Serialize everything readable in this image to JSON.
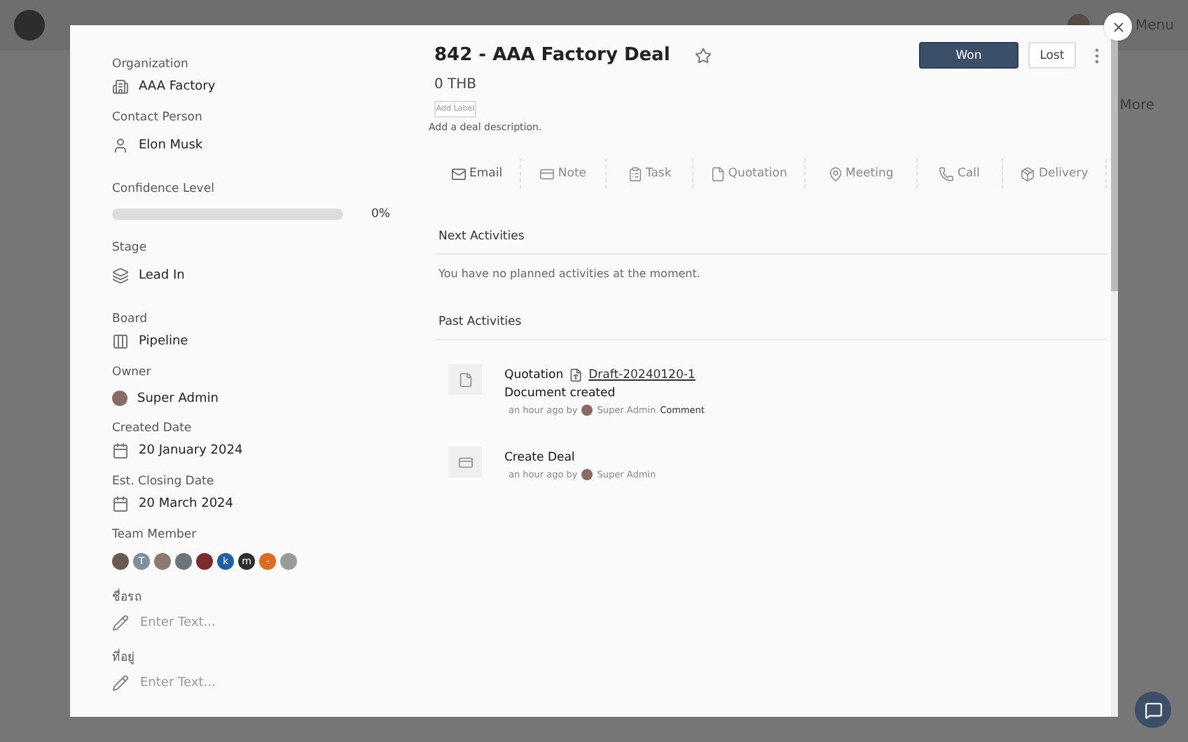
{
  "background": {
    "menu": "Menu",
    "more": "More"
  },
  "deal": {
    "title": "842 - AAA Factory Deal",
    "starred": false,
    "amount": "0 THB",
    "add_label": "Add Label",
    "description": "Add a deal description.",
    "won": "Won",
    "lost": "Lost"
  },
  "fields": [
    {
      "kind": "organization",
      "label": "Organization",
      "value": "AAA Factory"
    },
    {
      "kind": "contact",
      "label": "Contact Person",
      "value": "Elon Musk"
    },
    {
      "kind": "confidence",
      "label": "Confidence Level",
      "level": 0,
      "reading": "0%"
    },
    {
      "kind": "stage",
      "label": "Stage",
      "value": "Lead In"
    },
    {
      "kind": "board",
      "label": "Board",
      "value": "Pipeline"
    },
    {
      "kind": "owner",
      "label": "Owner",
      "value": "Super Admin"
    },
    {
      "kind": "date",
      "label": "Created Date",
      "value": "20 January 2024"
    },
    {
      "kind": "date",
      "label": "Est. Closing Date",
      "value": "20 March 2024"
    },
    {
      "kind": "team",
      "label": "Team Member"
    },
    {
      "kind": "input",
      "label": "ชื่อรถ",
      "placeholder": "Enter Text..."
    },
    {
      "kind": "input",
      "label": "ที่อยู่",
      "placeholder": "Enter Text..."
    }
  ],
  "team": [
    {
      "color": "#6b5a52"
    },
    {
      "color": "#7d8e9c",
      "initial": "T"
    },
    {
      "color": "#8a7a70"
    },
    {
      "color": "#6f7478"
    },
    {
      "color": "#7a2b2b"
    },
    {
      "color": "#1f5fa8",
      "initial": "k"
    },
    {
      "color": "#2e2e2e",
      "initial": "m"
    },
    {
      "color": "#e06a1e",
      "initial": "-"
    },
    {
      "color": "#9a9a9a"
    }
  ],
  "actions": [
    {
      "kind": "email",
      "label": "Email"
    },
    {
      "kind": "note",
      "label": "Note"
    },
    {
      "kind": "task",
      "label": "Task"
    },
    {
      "kind": "quotation",
      "label": "Quotation"
    },
    {
      "kind": "meeting",
      "label": "Meeting"
    },
    {
      "kind": "call",
      "label": "Call"
    },
    {
      "kind": "delivery",
      "label": "Delivery"
    }
  ],
  "next_activities": {
    "title": "Next Activities",
    "empty": "You have no planned activities at the moment."
  },
  "past_activities": {
    "title": "Past Activities",
    "items": [
      {
        "kind": "document",
        "type": "Quotation",
        "link": "Draft-20240120-1",
        "detail": "Document created",
        "time": "an hour ago by",
        "user": "Super Admin",
        "comment": "Comment"
      },
      {
        "kind": "deal",
        "type": "Create Deal",
        "time": "an hour ago by",
        "user": "Super Admin"
      }
    ]
  }
}
